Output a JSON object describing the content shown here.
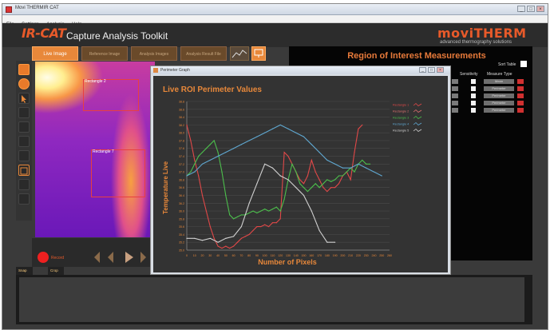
{
  "window": {
    "title": "Movi THERMIR CAT",
    "min": "_",
    "max": "□",
    "close": "×"
  },
  "menu": [
    "File",
    "Settings",
    "Analysis",
    "Help"
  ],
  "header": {
    "brand": "IR-CAT",
    "subtitle": "Capture Analysis Toolkit",
    "logo": "moviTHERM",
    "tagline": "advanced thermography solutions"
  },
  "tabs": [
    "Live Image",
    "Reference Image",
    "Analysis Images",
    "Analysis Result File"
  ],
  "thermal": {
    "roi1": "Rectangle 2",
    "roi2": "Rectangle 7"
  },
  "controls": {
    "record": "Record"
  },
  "roi_panel": {
    "title": "Region of Interest  Measurements",
    "sort_label": "Sort Table",
    "columns": [
      "Sensitivity",
      "Measure Type"
    ],
    "rows": [
      {
        "measure": "Mean"
      },
      {
        "measure": "Perimeter"
      },
      {
        "measure": "Perimeter"
      },
      {
        "measure": "Perimeter"
      },
      {
        "measure": "Perimeter"
      }
    ]
  },
  "bottom_tabs": [
    "Snap Images",
    "Crop Videos"
  ],
  "graph_window": {
    "title": "Perimeter Graph",
    "min": "_",
    "max": "□",
    "close": "×"
  },
  "chart_data": {
    "type": "line",
    "title": "Live ROI Perimeter Values",
    "xlabel": "Number of Pixels",
    "ylabel": "Temperature Live",
    "xlim": [
      0,
      260
    ],
    "ylim": [
      35.0,
      38.8
    ],
    "grid": true,
    "legend_position": "top-right",
    "x_ticks": [
      0,
      10,
      20,
      30,
      40,
      50,
      60,
      70,
      80,
      90,
      100,
      110,
      120,
      130,
      140,
      150,
      160,
      170,
      180,
      190,
      200,
      210,
      220,
      230,
      240,
      250,
      260
    ],
    "y_ticks": [
      35.0,
      35.2,
      35.4,
      35.6,
      35.8,
      36.0,
      36.2,
      36.4,
      36.6,
      36.8,
      37.0,
      37.2,
      37.4,
      37.6,
      37.8,
      38.0,
      38.2,
      38.4,
      38.6,
      38.8
    ],
    "series": [
      {
        "name": "Rectangle 1",
        "color": "#e04848",
        "x": [
          0,
          5,
          10,
          15,
          20,
          25,
          30,
          35,
          40,
          45,
          50,
          55,
          60,
          65,
          70,
          75,
          80,
          85,
          90,
          95,
          100,
          105,
          110,
          115,
          120,
          125,
          130,
          135,
          140,
          145,
          150,
          155,
          160,
          165,
          170,
          175,
          180,
          185,
          190,
          195,
          200,
          205,
          210,
          215,
          220,
          225
        ],
        "y": [
          38.2,
          37.8,
          37.3,
          36.9,
          36.4,
          36.0,
          35.6,
          35.3,
          35.1,
          35.05,
          35.1,
          35.05,
          35.1,
          35.2,
          35.3,
          35.35,
          35.4,
          35.5,
          35.6,
          35.6,
          35.65,
          35.6,
          35.7,
          35.7,
          35.8,
          37.5,
          37.4,
          37.2,
          37.0,
          36.8,
          36.7,
          36.9,
          37.3,
          37.0,
          36.8,
          36.6,
          36.5,
          36.6,
          36.6,
          36.7,
          36.9,
          37.0,
          36.8,
          37.5,
          38.1,
          38.2
        ]
      },
      {
        "name": "Rectangle 2",
        "color": "#e07070",
        "x": [],
        "y": []
      },
      {
        "name": "Rectangle 3",
        "color": "#4cbe4c",
        "x": [
          0,
          5,
          10,
          15,
          20,
          25,
          30,
          35,
          40,
          45,
          50,
          55,
          60,
          65,
          70,
          75,
          80,
          85,
          90,
          95,
          100,
          105,
          110,
          115,
          120,
          125,
          130,
          135,
          140,
          145,
          150,
          155,
          160,
          165,
          170,
          175,
          180,
          185,
          190,
          195,
          200,
          205,
          210,
          215,
          220,
          225,
          230,
          235
        ],
        "y": [
          36.9,
          37.0,
          37.2,
          37.4,
          37.5,
          37.6,
          37.7,
          37.8,
          37.5,
          37.0,
          36.4,
          35.9,
          35.8,
          35.85,
          35.9,
          35.9,
          35.95,
          36.0,
          35.95,
          36.0,
          36.05,
          36.0,
          36.05,
          36.1,
          36.0,
          36.3,
          36.8,
          37.2,
          37.0,
          36.7,
          36.6,
          36.5,
          36.6,
          36.7,
          36.6,
          36.7,
          36.8,
          36.75,
          36.8,
          36.9,
          36.9,
          37.0,
          37.1,
          37.0,
          37.2,
          37.3,
          37.2,
          37.2
        ]
      },
      {
        "name": "Rectangle 4",
        "color": "#5fa7d0",
        "x": [
          0,
          10,
          20,
          30,
          40,
          50,
          60,
          70,
          80,
          90,
          100,
          110,
          120,
          130,
          140,
          150,
          160,
          170,
          180,
          190,
          200,
          210,
          220,
          230,
          240,
          250
        ],
        "y": [
          36.9,
          37.0,
          37.2,
          37.3,
          37.4,
          37.5,
          37.6,
          37.7,
          37.8,
          37.9,
          38.0,
          38.1,
          38.2,
          38.1,
          38.0,
          37.9,
          37.7,
          37.5,
          37.3,
          37.2,
          37.1,
          37.1,
          37.2,
          37.1,
          37.0,
          36.9
        ]
      },
      {
        "name": "Rectangle 5",
        "color": "#d0d0d0",
        "x": [
          0,
          10,
          20,
          30,
          40,
          50,
          60,
          70,
          80,
          90,
          100,
          110,
          120,
          130,
          140,
          150,
          160,
          170,
          180,
          190
        ],
        "y": [
          35.3,
          35.3,
          35.25,
          35.3,
          35.2,
          35.3,
          35.35,
          35.6,
          36.2,
          36.7,
          37.2,
          37.1,
          36.9,
          36.8,
          36.6,
          36.4,
          36.0,
          35.5,
          35.2,
          35.2
        ]
      }
    ]
  }
}
